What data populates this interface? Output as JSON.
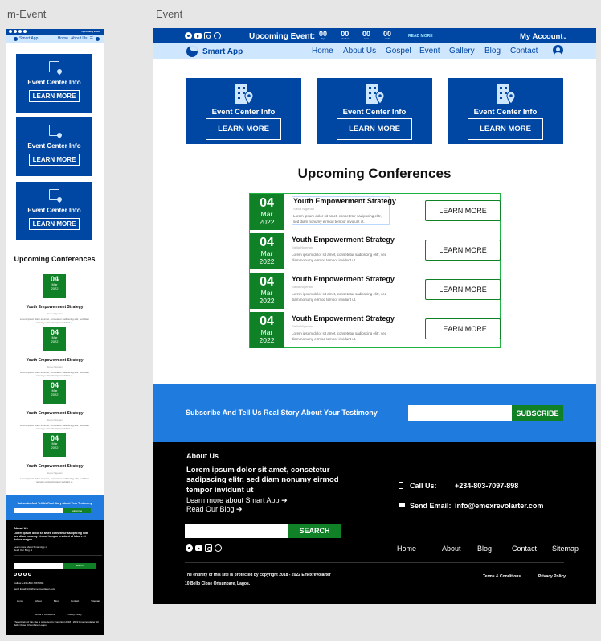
{
  "canvas": {
    "mobile_label": "m-Event",
    "desktop_label": "Event"
  },
  "topbar": {
    "upcoming_label": "Upcoming Event:",
    "countdown": [
      {
        "value": "00",
        "unit": "days"
      },
      {
        "value": "00",
        "unit": "minutes"
      },
      {
        "value": "00",
        "unit": "secs"
      },
      {
        "value": "00",
        "unit": "ends"
      }
    ],
    "read_more": "READ MORE",
    "account": "My Account",
    "account_caret": "⌄",
    "socials": [
      "facebook-icon",
      "youtube-icon",
      "instagram-icon",
      "whatsapp-icon"
    ]
  },
  "navbar": {
    "brand": "Smart App",
    "menu": [
      "Home",
      "About Us",
      "Gospel",
      "Event",
      "Gallery",
      "Blog",
      "Contact"
    ]
  },
  "event_cards": [
    {
      "title": "Event Center Info",
      "button": "LEARN MORE"
    },
    {
      "title": "Event Center Info",
      "button": "LEARN MORE"
    },
    {
      "title": "Event Center Info",
      "button": "LEARN MORE"
    }
  ],
  "conferences": {
    "heading": "Upcoming Conferences",
    "items": [
      {
        "day": "04",
        "month": "Mar",
        "year": "2022",
        "title": "Youth Empowerment Strategy",
        "subtitle": "Stella Nigerian",
        "text": "Lorem ipsum dolor sit amet, consetetur sadipscing elitr, sed diam nonumy eirmod tempor invidunt ut.",
        "button": "LEARN MORE"
      },
      {
        "day": "04",
        "month": "Mar",
        "year": "2022",
        "title": "Youth Empowerment Strategy",
        "subtitle": "Stella Nigerian",
        "text": "Lorem ipsum dolor sit amet, consetetur sadipscing elitr, sed diam nonumy eirmod tempor invidunt ut.",
        "button": "LEARN MORE"
      },
      {
        "day": "04",
        "month": "Mar",
        "year": "2022",
        "title": "Youth Empowerment Strategy",
        "subtitle": "Stella Nigerian",
        "text": "Lorem ipsum dolor sit amet, consetetur sadipscing elitr, sed diam nonumy eirmod tempor invidunt ut.",
        "button": "LEARN MORE"
      },
      {
        "day": "04",
        "month": "Mar",
        "year": "2022",
        "title": "Youth Empowerment Strategy",
        "subtitle": "Stella Nigerian",
        "text": "Lorem ipsum dolor sit amet, consetetur sadipscing elitr, sed diam nonumy eirmod tempor invidunt ut.",
        "button": "LEARN MORE"
      }
    ]
  },
  "subscribe": {
    "text": "Subscribe And Tell Us Real Story About Your Testimony",
    "input_value": "",
    "button": "SUBSCRIBE"
  },
  "footer": {
    "about_heading": "About Us",
    "about_text": "Lorem ipsum dolor sit amet, consetetur sadipscing elitr, sed diam nonumy eirmod tempor invidunt ut",
    "link1": "Learn more about Smart App ➔",
    "link2": "Read Our Blog ➔",
    "search_value": "",
    "search_button": "SEARCH",
    "call_label": "Call Us:",
    "call_value": "+234-803-7097-898",
    "email_label": "Send Email:",
    "email_value": "info@emexrevolarter.com",
    "nav": [
      "Home",
      "About",
      "Blog",
      "Contact",
      "Sitemap"
    ],
    "copyright": "The entirety of this site is protected by copyright  2018 - 2022 Emexrevolarter",
    "address": "10 Bello Close Orisunbare, Lagos.",
    "terms": "Terms & Conditions",
    "privacy": "Privacy Policy"
  },
  "mobile": {
    "topbar_upcoming": "Upcoming Event",
    "brand": "Smart App",
    "nav_short": [
      "Home",
      "About Us",
      "☰"
    ],
    "subscribe_text": "Subscribe And Tell Us Real Story About Your Testimony",
    "subscribe_button": "Subscribe",
    "search_button": "Search",
    "footer_about": "About Us",
    "footer_about_text": "Lorem ipsum dolor sit amet, consetetur sadipscing elitr, sed diam nonumy eirmod tempor invidunt ut labore et dolore magna.",
    "footer_link1": "Learn more about Smart App ➔",
    "footer_link2": "Read Our Blog ➔",
    "call": "Call us:     +234-803-7097-898",
    "email": "Send Email:     info@emexrevolarter.com",
    "footer_nav": [
      "Home",
      "About",
      "Blog",
      "Contact",
      "Sitemap"
    ],
    "terms": "Terms & Conditions",
    "privacy": "Privacy Policy",
    "copyright": "The entirety of this site is protected by copyright 2018 - 2022 Emexrevolarter 10 Bello Close Orisunbare, Lagos."
  },
  "colors": {
    "primary": "#0047a4",
    "nav_bg": "#cfe6ff",
    "accent_green": "#118128",
    "subscribe_bg": "#1f7bde",
    "footer_bg": "#000000"
  }
}
